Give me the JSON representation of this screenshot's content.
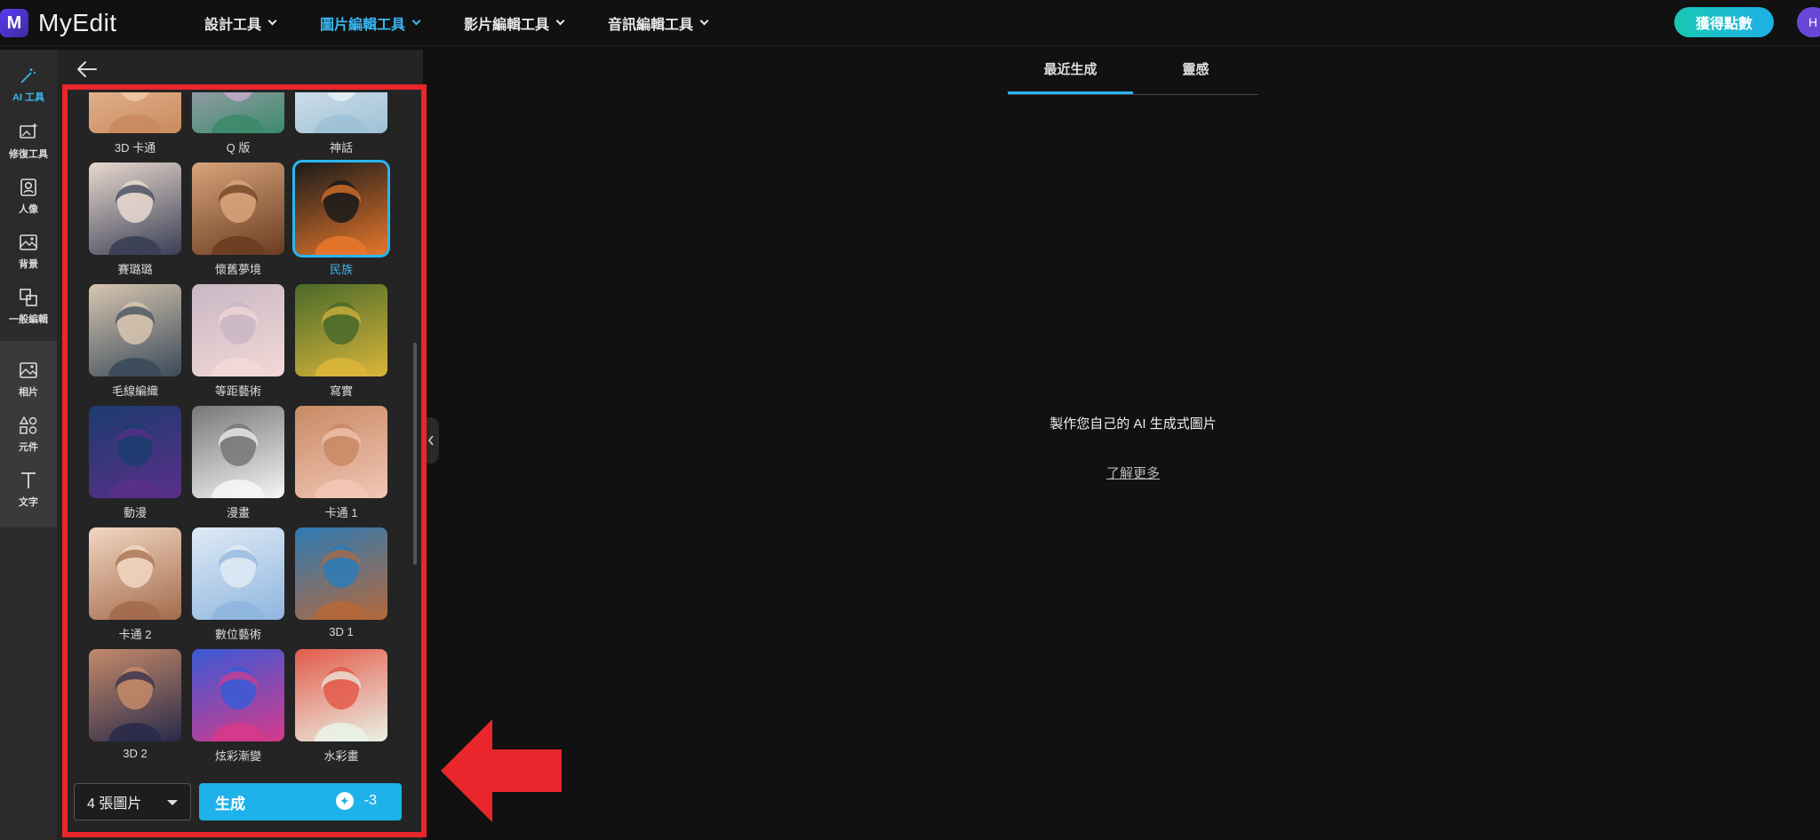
{
  "app": {
    "name": "MyEdit",
    "logo_letter": "M"
  },
  "nav": [
    {
      "label": "設計工具",
      "active": false
    },
    {
      "label": "圖片編輯工具",
      "active": true
    },
    {
      "label": "影片編輯工具",
      "active": false
    },
    {
      "label": "音訊編輯工具",
      "active": false
    }
  ],
  "header": {
    "points_label": "獲得點數",
    "avatar_initial": "H"
  },
  "rail": [
    {
      "label": "AI 工具",
      "icon": "magic-wand-icon",
      "active": true
    },
    {
      "label": "修復工具",
      "icon": "image-repair-icon",
      "active": false
    },
    {
      "label": "人像",
      "icon": "portrait-icon",
      "active": false
    },
    {
      "label": "背景",
      "icon": "background-icon",
      "active": false
    },
    {
      "label": "一般編輯",
      "icon": "crop-icon",
      "active": false
    },
    {
      "label": "相片",
      "icon": "photo-icon",
      "active": false
    },
    {
      "label": "元件",
      "icon": "shapes-icon",
      "active": false
    },
    {
      "label": "文字",
      "icon": "text-icon",
      "active": false
    }
  ],
  "styles": [
    {
      "label": "3D 卡通",
      "colors": [
        "#c98a5e",
        "#f0c9a6"
      ]
    },
    {
      "label": "Q 版",
      "colors": [
        "#3d8a6b",
        "#c6a9c9"
      ]
    },
    {
      "label": "神話",
      "colors": [
        "#9fc1d6",
        "#e8f0f4"
      ]
    },
    {
      "label": "賽璐璐",
      "colors": [
        "#3a3f55",
        "#e9d9cf"
      ]
    },
    {
      "label": "懷舊夢境",
      "colors": [
        "#6b3c22",
        "#d7a47a"
      ]
    },
    {
      "label": "民族",
      "colors": [
        "#e6772a",
        "#1a1a1a"
      ],
      "selected": true
    },
    {
      "label": "毛線編織",
      "colors": [
        "#3b4a5a",
        "#d8c6b0"
      ]
    },
    {
      "label": "等距藝術",
      "colors": [
        "#f3d9d6",
        "#c9b7c4"
      ]
    },
    {
      "label": "寫實",
      "colors": [
        "#d9b53a",
        "#4a6a2a"
      ]
    },
    {
      "label": "動漫",
      "colors": [
        "#5a2f8a",
        "#1c3c6e"
      ]
    },
    {
      "label": "漫畫",
      "colors": [
        "#f5f5f5",
        "#777777"
      ]
    },
    {
      "label": "卡通 1",
      "colors": [
        "#f2c6b6",
        "#c88a64"
      ]
    },
    {
      "label": "卡通 2",
      "colors": [
        "#a36a4c",
        "#f2d7c2"
      ]
    },
    {
      "label": "數位藝術",
      "colors": [
        "#8fb6df",
        "#dfeaf5"
      ]
    },
    {
      "label": "3D 1",
      "colors": [
        "#b5683a",
        "#2d7bb5"
      ]
    },
    {
      "label": "3D 2",
      "colors": [
        "#2a2a4a",
        "#c48a6a"
      ]
    },
    {
      "label": "炫彩漸變",
      "colors": [
        "#d63a8a",
        "#3a5ad6"
      ]
    },
    {
      "label": "水彩畫",
      "colors": [
        "#eaf2e6",
        "#e35a4a"
      ]
    }
  ],
  "controls": {
    "count_label": "4 張圖片",
    "generate_label": "生成",
    "cost_label": "-3"
  },
  "result_tabs": [
    "最近生成",
    "靈感"
  ],
  "empty_state": {
    "message": "製作您自己的 AI 生成式圖片",
    "learn_more": "了解更多"
  }
}
